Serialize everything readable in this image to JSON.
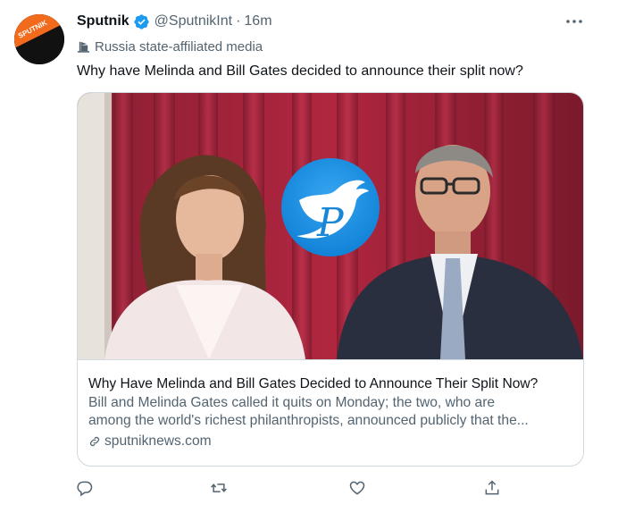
{
  "tweet": {
    "author_name": "Sputnik",
    "handle": "@SputnikInt",
    "separator": "·",
    "time": "16m",
    "label": "Russia state-affiliated media",
    "text": "Why have Melinda and Bill Gates decided to announce their split now?",
    "avatar_text": "SPUTNIK"
  },
  "card": {
    "title": "Why Have Melinda and Bill Gates Decided to Announce Their Split Now?",
    "description_line1": "Bill and Melinda Gates called it quits on Monday; the two, who are",
    "description_line2": "among the world's richest philanthropists, announced publicly that the...",
    "domain": "sputniknews.com",
    "watermark_letter": "P"
  },
  "icons": {
    "verified": "verified-badge-icon",
    "label": "state-media-flag-icon",
    "link": "link-icon",
    "reply": "reply-icon",
    "retweet": "retweet-icon",
    "like": "like-icon",
    "share": "share-icon",
    "more": "more-icon"
  },
  "colors": {
    "verified_blue": "#1d9bf0",
    "text_primary": "#0f1419",
    "text_secondary": "#536471",
    "border": "#cfd9de",
    "avatar_orange": "#f26a1b"
  }
}
